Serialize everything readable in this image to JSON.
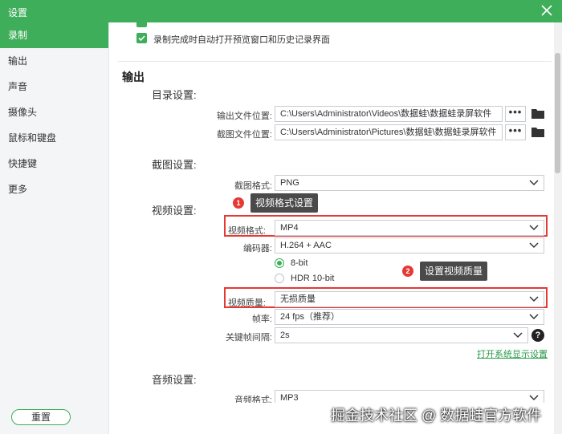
{
  "window": {
    "title": "设置"
  },
  "sidebar": {
    "items": [
      {
        "label": "录制"
      },
      {
        "label": "输出"
      },
      {
        "label": "声音"
      },
      {
        "label": "摄像头"
      },
      {
        "label": "鼠标和键盘"
      },
      {
        "label": "快捷键"
      },
      {
        "label": "更多"
      }
    ],
    "reset_label": "重置"
  },
  "recording": {
    "auto_open_label": "录制完成时自动打开预览窗口和历史记录界面",
    "auto_open_checked": true
  },
  "output": {
    "title": "输出",
    "directory": {
      "title": "目录设置:",
      "output_location_label": "输出文件位置:",
      "output_location_value": "C:\\Users\\Administrator\\Videos\\数据蛙\\数据蛙录屏软件",
      "screenshot_location_label": "截图文件位置:",
      "screenshot_location_value": "C:\\Users\\Administrator\\Pictures\\数据蛙\\数据蛙录屏软件",
      "browse_label": "•••"
    },
    "screenshot": {
      "title": "截图设置:",
      "format_label": "截图格式:",
      "format_value": "PNG"
    },
    "video": {
      "title": "视频设置:",
      "format_label": "视频格式:",
      "format_value": "MP4",
      "encoder_label": "编码器:",
      "encoder_value": "H.264 + AAC",
      "bit_depth_options": [
        "8-bit",
        "HDR 10-bit"
      ],
      "bit_depth_selected": "8-bit",
      "quality_label": "视频质量:",
      "quality_value": "无损质量",
      "fps_label": "帧率:",
      "fps_value": "24 fps（推荐）",
      "keyframe_label": "关键帧间隔:",
      "keyframe_value": "2s",
      "help_label": "?",
      "display_settings_link": "打开系统显示设置"
    },
    "audio": {
      "title": "音频设置:",
      "format_label": "音频格式:",
      "format_value": "MP3"
    }
  },
  "annotations": {
    "badge1": "1",
    "tip1": "视频格式设置",
    "badge2": "2",
    "tip2": "设置视频质量"
  },
  "watermark": "掘金技术社区 @ 数据蛙官方软件",
  "colors": {
    "accent": "#3fae5a",
    "highlight": "#e53935",
    "tooltip": "#4a4a4a"
  }
}
